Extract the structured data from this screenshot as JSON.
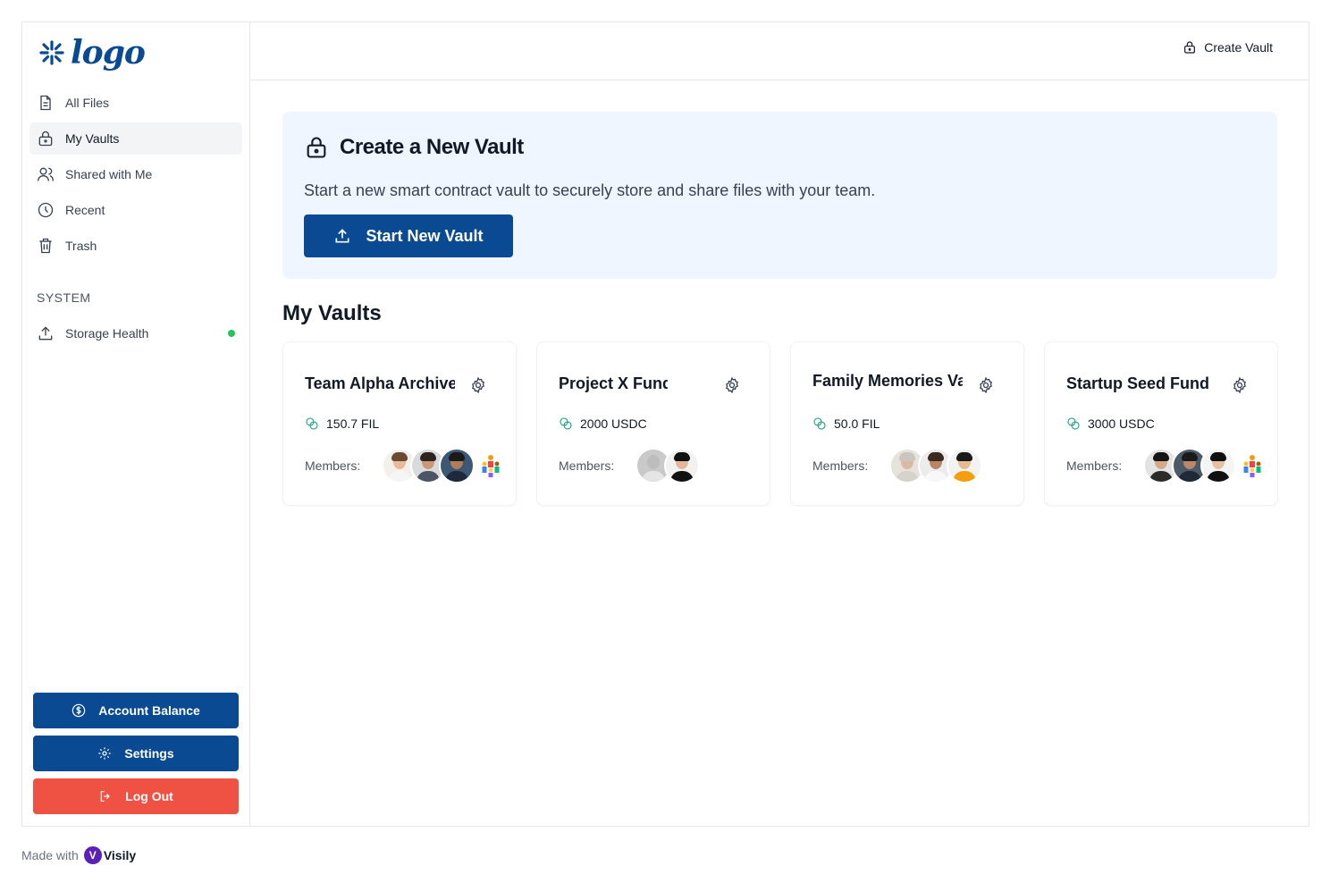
{
  "sidebar": {
    "logo_text": "logo",
    "nav": [
      {
        "label": "All Files",
        "icon": "file-icon"
      },
      {
        "label": "My Vaults",
        "icon": "lock-icon",
        "active": true
      },
      {
        "label": "Shared with Me",
        "icon": "users-icon"
      },
      {
        "label": "Recent",
        "icon": "clock-icon"
      },
      {
        "label": "Trash",
        "icon": "trash-icon"
      }
    ],
    "section_label": "SYSTEM",
    "system": [
      {
        "label": "Storage Health",
        "icon": "upload-icon",
        "status_color": "#22c55e"
      }
    ],
    "buttons": {
      "account_balance": "Account Balance",
      "settings": "Settings",
      "logout": "Log Out"
    }
  },
  "topbar": {
    "create_vault": "Create Vault"
  },
  "hero": {
    "title": "Create a New Vault",
    "subtitle": "Start a new smart contract vault to securely store and share files with your team.",
    "button": "Start New Vault"
  },
  "vaults": {
    "title": "My Vaults",
    "members_label": "Members:",
    "items": [
      {
        "name": "Team Alpha Archive",
        "amount": "150.7 FIL"
      },
      {
        "name": "Project X Fund",
        "amount": "2000 USDC"
      },
      {
        "name": "Family Memories Vault",
        "amount": "50.0 FIL"
      },
      {
        "name": "Startup Seed Fund",
        "amount": "3000 USDC"
      }
    ]
  },
  "footer": {
    "made_with": "Made with",
    "brand": "Visily"
  },
  "colors": {
    "primary": "#0a4a92",
    "danger": "#ef5142",
    "hero_bg": "#eff6ff",
    "health_ok": "#22c55e",
    "crypto_icon": "#0f9d7a"
  }
}
